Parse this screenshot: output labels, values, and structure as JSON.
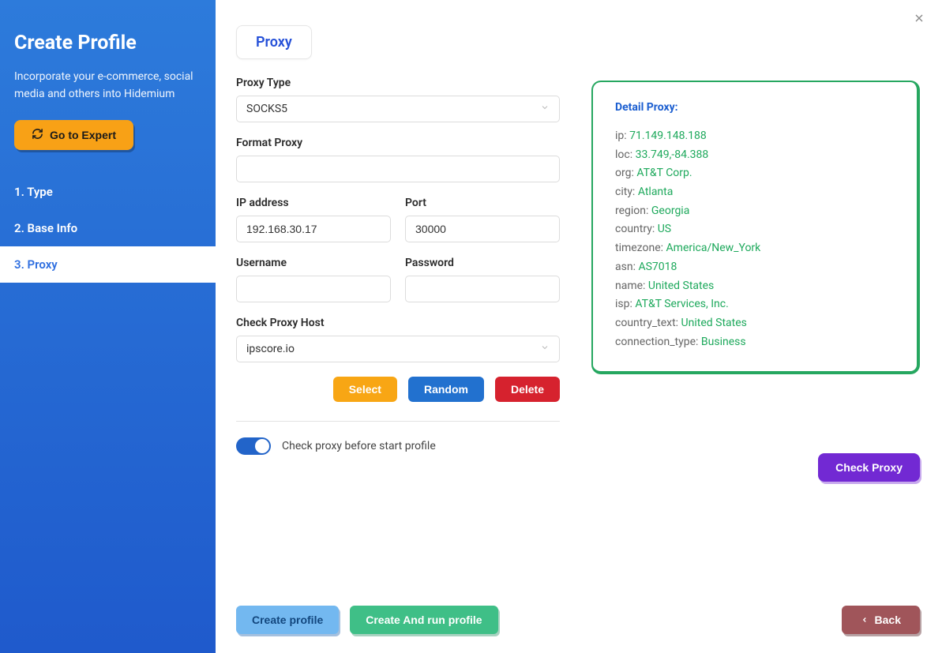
{
  "sidebar": {
    "title": "Create Profile",
    "description": "Incorporate your e-commerce, social media and others into Hidemium",
    "expert_button": "Go to Expert",
    "nav": [
      {
        "label": "1. Type"
      },
      {
        "label": "2. Base Info"
      },
      {
        "label": "3. Proxy"
      }
    ]
  },
  "tab": {
    "label": "Proxy"
  },
  "form": {
    "proxy_type": {
      "label": "Proxy Type",
      "value": "SOCKS5"
    },
    "format_proxy": {
      "label": "Format Proxy",
      "value": ""
    },
    "ip": {
      "label": "IP address",
      "value": "192.168.30.17"
    },
    "port": {
      "label": "Port",
      "value": "30000"
    },
    "username": {
      "label": "Username",
      "value": ""
    },
    "password": {
      "label": "Password",
      "value": ""
    },
    "check_host": {
      "label": "Check Proxy Host",
      "value": "ipscore.io"
    },
    "buttons": {
      "select": "Select",
      "random": "Random",
      "delete": "Delete"
    },
    "toggle_label": "Check proxy before start profile"
  },
  "detail": {
    "title": "Detail Proxy:",
    "rows": [
      {
        "key": "ip: ",
        "val": "71.149.148.188"
      },
      {
        "key": "loc: ",
        "val": "33.749,-84.388"
      },
      {
        "key": "org: ",
        "val": "AT&T Corp."
      },
      {
        "key": "city: ",
        "val": "Atlanta"
      },
      {
        "key": "region: ",
        "val": "Georgia"
      },
      {
        "key": "country: ",
        "val": "US"
      },
      {
        "key": "timezone: ",
        "val": "America/New_York"
      },
      {
        "key": "asn: ",
        "val": "AS7018"
      },
      {
        "key": "name: ",
        "val": "United States"
      },
      {
        "key": "isp: ",
        "val": "AT&T Services, Inc."
      },
      {
        "key": "country_text: ",
        "val": "United States"
      },
      {
        "key": "connection_type: ",
        "val": "Business"
      }
    ],
    "check_button": "Check Proxy"
  },
  "footer": {
    "create": "Create profile",
    "run": "Create And run profile",
    "back": "Back"
  }
}
